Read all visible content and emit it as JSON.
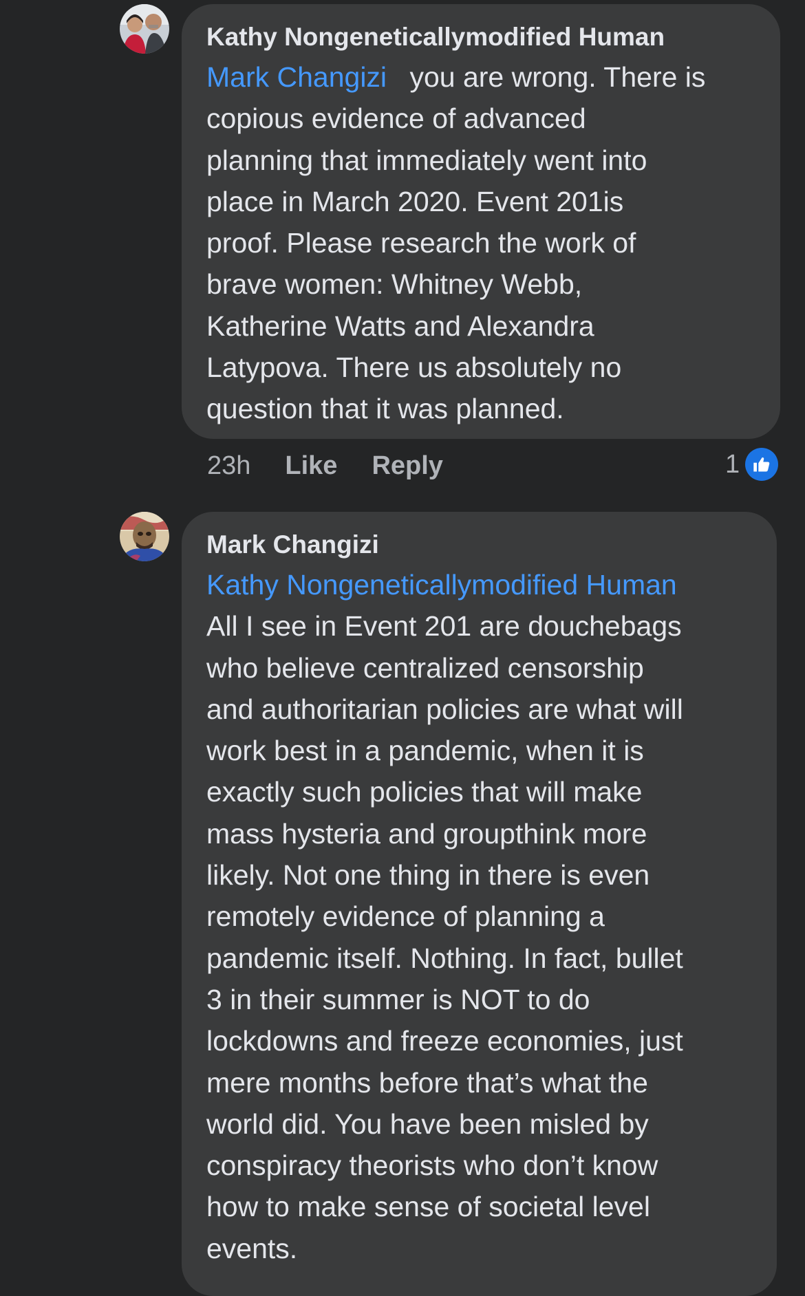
{
  "comments": [
    {
      "author": "Kathy Nongeneticallymodified Human",
      "mention": "Mark Changizi",
      "text_lines": [
        "you are wrong. There is",
        "copious evidence of advanced",
        "planning that immediately went into",
        "place in March 2020. Event 201is",
        "proof. Please research the work of",
        "brave women: Whitney Webb,",
        "Katherine Watts and Alexandra",
        "Latypova. There us absolutely no",
        "question that it was planned."
      ],
      "time": "23h",
      "like_label": "Like",
      "reply_label": "Reply",
      "reaction_count": "1",
      "reaction_icon": "thumbs-up-icon"
    },
    {
      "author": "Mark Changizi",
      "mention": "Kathy Nongeneticallymodified Human",
      "text_lines": [
        "All I see in Event 201 are douchebags",
        "who believe centralized censorship",
        "and authoritarian policies are what will",
        "work best in a pandemic, when it is",
        "exactly such policies that will make",
        "mass hysteria and groupthink more",
        "likely. Not one thing in there is even",
        "remotely evidence of planning a",
        "pandemic itself. Nothing. In fact, bullet",
        "3 in their summer is NOT to do",
        "lockdowns and freeze economies, just",
        "mere months before that’s what the",
        "world did. You have been misled by",
        "conspiracy theorists who don’t know",
        "how to make sense of societal level",
        "events."
      ]
    }
  ],
  "colors": {
    "background": "#242526",
    "bubble": "#3a3b3c",
    "text": "#e4e6eb",
    "mention": "#4599ff",
    "secondary_text": "#b0b3b8",
    "like_blue": "#1b74e4"
  }
}
